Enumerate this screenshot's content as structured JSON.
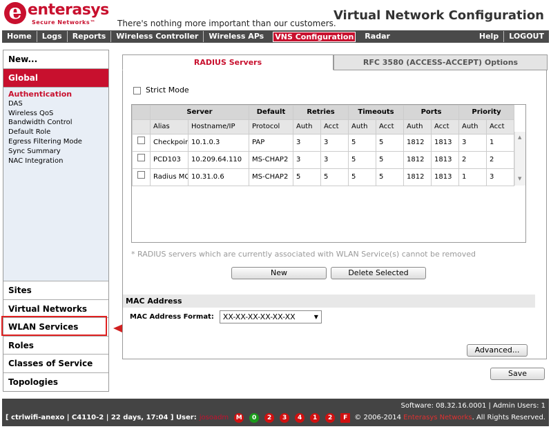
{
  "header": {
    "brand": "enterasys",
    "brand_sub": "Secure Networks™",
    "tagline": "There's nothing more important than our customers.",
    "title": "Virtual Network Configuration"
  },
  "nav": {
    "items": [
      "Home",
      "Logs",
      "Reports",
      "Wireless Controller",
      "Wireless APs",
      "VNS Configuration",
      "Radar"
    ],
    "active": "VNS Configuration",
    "right": [
      "Help",
      "LOGOUT"
    ]
  },
  "sidebar": {
    "new": "New...",
    "global": "Global",
    "links": [
      "Authentication",
      "DAS",
      "Wireless QoS",
      "Bandwidth Control",
      "Default Role",
      "Egress Filtering Mode",
      "Sync Summary",
      "NAC Integration"
    ],
    "current_link": "Authentication",
    "sections": [
      "Sites",
      "Virtual Networks",
      "WLAN Services",
      "Roles",
      "Classes of Service",
      "Topologies"
    ]
  },
  "tabs": [
    "RADIUS Servers",
    "RFC 3580 (ACCESS-ACCEPT) Options"
  ],
  "strict_mode_label": "Strict Mode",
  "grid": {
    "group_headers": [
      "Server",
      "Default",
      "Retries",
      "Timeouts",
      "Ports",
      "Priority"
    ],
    "sub_headers": [
      "Alias",
      "Hostname/IP",
      "Protocol",
      "Auth",
      "Acct",
      "Auth",
      "Acct",
      "Auth",
      "Acct",
      "Auth",
      "Acct"
    ],
    "rows": [
      {
        "alias": "Checkpoin",
        "host": "10.1.0.3",
        "protocol": "PAP",
        "retries_auth": "3",
        "retries_acct": "3",
        "timeouts_auth": "5",
        "timeouts_acct": "5",
        "port_auth": "1812",
        "port_acct": "1813",
        "prio_auth": "3",
        "prio_acct": "1"
      },
      {
        "alias": "PCD103",
        "host": "10.209.64.110",
        "protocol": "MS-CHAP2",
        "retries_auth": "3",
        "retries_acct": "3",
        "timeouts_auth": "5",
        "timeouts_acct": "5",
        "port_auth": "1812",
        "port_acct": "1813",
        "prio_auth": "2",
        "prio_acct": "2"
      },
      {
        "alias": "Radius MC",
        "host": "10.31.0.6",
        "protocol": "MS-CHAP2",
        "retries_auth": "5",
        "retries_acct": "5",
        "timeouts_auth": "5",
        "timeouts_acct": "5",
        "port_auth": "1812",
        "port_acct": "1813",
        "prio_auth": "1",
        "prio_acct": "3"
      }
    ]
  },
  "note": "* RADIUS servers which are currently associated with WLAN Service(s) cannot be removed",
  "buttons": {
    "new": "New",
    "delete": "Delete Selected",
    "advanced": "Advanced...",
    "save": "Save"
  },
  "mac": {
    "section_title": "MAC Address",
    "format_label": "MAC Address Format:",
    "format_value": "XX-XX-XX-XX-XX-XX"
  },
  "footer": {
    "software": "Software: 08.32.16.0001 | Admin Users: 1",
    "status": "[ ctrlwifi-anexo | C4110-2 | 22 days, 17:04 ] User:",
    "user": "josoadm",
    "icons": [
      {
        "label": "M",
        "color": "#d01010"
      },
      {
        "label": "0",
        "color": "#1a9a1a"
      },
      {
        "label": "2",
        "color": "#d01010"
      },
      {
        "label": "3",
        "color": "#d01010"
      },
      {
        "label": "4",
        "color": "#d01010"
      },
      {
        "label": "1",
        "color": "#d01010"
      },
      {
        "label": "2",
        "color": "#d01010"
      },
      {
        "label": "F",
        "color": "#d01010"
      }
    ],
    "copyright_prefix": "© 2006-2014",
    "company": "Enterasys Networks",
    "copyright_suffix": ". All Rights Reserved."
  }
}
